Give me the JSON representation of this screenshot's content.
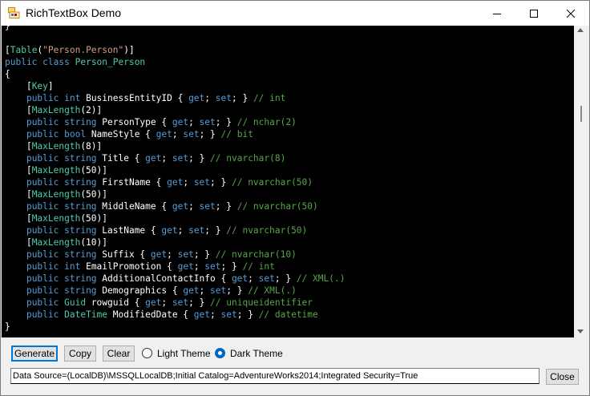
{
  "window": {
    "title": "RichTextBox Demo",
    "icon": "app-icon"
  },
  "title_buttons": {
    "minimize": "minimize-icon",
    "maximize": "maximize-icon",
    "close": "close-icon"
  },
  "colors": {
    "editor_bg": "#000000",
    "text": "#ffffff",
    "keyword": "#569cd6",
    "type": "#4ec9b0",
    "string": "#d69d85",
    "comment": "#57a64a",
    "accent": "#0078d7"
  },
  "code_lines": [
    [
      {
        "t": "}",
        "c": "text"
      }
    ],
    [
      {
        "t": "",
        "c": "text"
      }
    ],
    [
      {
        "t": "[",
        "c": "text"
      },
      {
        "t": "Table",
        "c": "type"
      },
      {
        "t": "(",
        "c": "text"
      },
      {
        "t": "\"Person.Person\"",
        "c": "string"
      },
      {
        "t": ")]",
        "c": "text"
      }
    ],
    [
      {
        "t": "public",
        "c": "keyword"
      },
      {
        "t": " ",
        "c": "text"
      },
      {
        "t": "class",
        "c": "keyword"
      },
      {
        "t": " ",
        "c": "text"
      },
      {
        "t": "Person_Person",
        "c": "type"
      }
    ],
    [
      {
        "t": "{",
        "c": "text"
      }
    ],
    [
      {
        "t": "    [",
        "c": "text"
      },
      {
        "t": "Key",
        "c": "type"
      },
      {
        "t": "]",
        "c": "text"
      }
    ],
    [
      {
        "t": "    ",
        "c": "text"
      },
      {
        "t": "public",
        "c": "keyword"
      },
      {
        "t": " ",
        "c": "text"
      },
      {
        "t": "int",
        "c": "keyword"
      },
      {
        "t": " BusinessEntityID { ",
        "c": "text"
      },
      {
        "t": "get",
        "c": "keyword"
      },
      {
        "t": "; ",
        "c": "text"
      },
      {
        "t": "set",
        "c": "keyword"
      },
      {
        "t": "; } ",
        "c": "text"
      },
      {
        "t": "// int",
        "c": "comment"
      }
    ],
    [
      {
        "t": "    [",
        "c": "text"
      },
      {
        "t": "MaxLength",
        "c": "type"
      },
      {
        "t": "(2)]",
        "c": "text"
      }
    ],
    [
      {
        "t": "    ",
        "c": "text"
      },
      {
        "t": "public",
        "c": "keyword"
      },
      {
        "t": " ",
        "c": "text"
      },
      {
        "t": "string",
        "c": "keyword"
      },
      {
        "t": " PersonType { ",
        "c": "text"
      },
      {
        "t": "get",
        "c": "keyword"
      },
      {
        "t": "; ",
        "c": "text"
      },
      {
        "t": "set",
        "c": "keyword"
      },
      {
        "t": "; } ",
        "c": "text"
      },
      {
        "t": "// nchar(2)",
        "c": "comment"
      }
    ],
    [
      {
        "t": "    ",
        "c": "text"
      },
      {
        "t": "public",
        "c": "keyword"
      },
      {
        "t": " ",
        "c": "text"
      },
      {
        "t": "bool",
        "c": "keyword"
      },
      {
        "t": " NameStyle { ",
        "c": "text"
      },
      {
        "t": "get",
        "c": "keyword"
      },
      {
        "t": "; ",
        "c": "text"
      },
      {
        "t": "set",
        "c": "keyword"
      },
      {
        "t": "; } ",
        "c": "text"
      },
      {
        "t": "// bit",
        "c": "comment"
      }
    ],
    [
      {
        "t": "    [",
        "c": "text"
      },
      {
        "t": "MaxLength",
        "c": "type"
      },
      {
        "t": "(8)]",
        "c": "text"
      }
    ],
    [
      {
        "t": "    ",
        "c": "text"
      },
      {
        "t": "public",
        "c": "keyword"
      },
      {
        "t": " ",
        "c": "text"
      },
      {
        "t": "string",
        "c": "keyword"
      },
      {
        "t": " Title { ",
        "c": "text"
      },
      {
        "t": "get",
        "c": "keyword"
      },
      {
        "t": "; ",
        "c": "text"
      },
      {
        "t": "set",
        "c": "keyword"
      },
      {
        "t": "; } ",
        "c": "text"
      },
      {
        "t": "// nvarchar(8)",
        "c": "comment"
      }
    ],
    [
      {
        "t": "    [",
        "c": "text"
      },
      {
        "t": "MaxLength",
        "c": "type"
      },
      {
        "t": "(50)]",
        "c": "text"
      }
    ],
    [
      {
        "t": "    ",
        "c": "text"
      },
      {
        "t": "public",
        "c": "keyword"
      },
      {
        "t": " ",
        "c": "text"
      },
      {
        "t": "string",
        "c": "keyword"
      },
      {
        "t": " FirstName { ",
        "c": "text"
      },
      {
        "t": "get",
        "c": "keyword"
      },
      {
        "t": "; ",
        "c": "text"
      },
      {
        "t": "set",
        "c": "keyword"
      },
      {
        "t": "; } ",
        "c": "text"
      },
      {
        "t": "// nvarchar(50)",
        "c": "comment"
      }
    ],
    [
      {
        "t": "    [",
        "c": "text"
      },
      {
        "t": "MaxLength",
        "c": "type"
      },
      {
        "t": "(50)]",
        "c": "text"
      }
    ],
    [
      {
        "t": "    ",
        "c": "text"
      },
      {
        "t": "public",
        "c": "keyword"
      },
      {
        "t": " ",
        "c": "text"
      },
      {
        "t": "string",
        "c": "keyword"
      },
      {
        "t": " MiddleName { ",
        "c": "text"
      },
      {
        "t": "get",
        "c": "keyword"
      },
      {
        "t": "; ",
        "c": "text"
      },
      {
        "t": "set",
        "c": "keyword"
      },
      {
        "t": "; } ",
        "c": "text"
      },
      {
        "t": "// nvarchar(50)",
        "c": "comment"
      }
    ],
    [
      {
        "t": "    [",
        "c": "text"
      },
      {
        "t": "MaxLength",
        "c": "type"
      },
      {
        "t": "(50)]",
        "c": "text"
      }
    ],
    [
      {
        "t": "    ",
        "c": "text"
      },
      {
        "t": "public",
        "c": "keyword"
      },
      {
        "t": " ",
        "c": "text"
      },
      {
        "t": "string",
        "c": "keyword"
      },
      {
        "t": " LastName { ",
        "c": "text"
      },
      {
        "t": "get",
        "c": "keyword"
      },
      {
        "t": "; ",
        "c": "text"
      },
      {
        "t": "set",
        "c": "keyword"
      },
      {
        "t": "; } ",
        "c": "text"
      },
      {
        "t": "// nvarchar(50)",
        "c": "comment"
      }
    ],
    [
      {
        "t": "    [",
        "c": "text"
      },
      {
        "t": "MaxLength",
        "c": "type"
      },
      {
        "t": "(10)]",
        "c": "text"
      }
    ],
    [
      {
        "t": "    ",
        "c": "text"
      },
      {
        "t": "public",
        "c": "keyword"
      },
      {
        "t": " ",
        "c": "text"
      },
      {
        "t": "string",
        "c": "keyword"
      },
      {
        "t": " Suffix { ",
        "c": "text"
      },
      {
        "t": "get",
        "c": "keyword"
      },
      {
        "t": "; ",
        "c": "text"
      },
      {
        "t": "set",
        "c": "keyword"
      },
      {
        "t": "; } ",
        "c": "text"
      },
      {
        "t": "// nvarchar(10)",
        "c": "comment"
      }
    ],
    [
      {
        "t": "    ",
        "c": "text"
      },
      {
        "t": "public",
        "c": "keyword"
      },
      {
        "t": " ",
        "c": "text"
      },
      {
        "t": "int",
        "c": "keyword"
      },
      {
        "t": " EmailPromotion { ",
        "c": "text"
      },
      {
        "t": "get",
        "c": "keyword"
      },
      {
        "t": "; ",
        "c": "text"
      },
      {
        "t": "set",
        "c": "keyword"
      },
      {
        "t": "; } ",
        "c": "text"
      },
      {
        "t": "// int",
        "c": "comment"
      }
    ],
    [
      {
        "t": "    ",
        "c": "text"
      },
      {
        "t": "public",
        "c": "keyword"
      },
      {
        "t": " ",
        "c": "text"
      },
      {
        "t": "string",
        "c": "keyword"
      },
      {
        "t": " AdditionalContactInfo { ",
        "c": "text"
      },
      {
        "t": "get",
        "c": "keyword"
      },
      {
        "t": "; ",
        "c": "text"
      },
      {
        "t": "set",
        "c": "keyword"
      },
      {
        "t": "; } ",
        "c": "text"
      },
      {
        "t": "// XML(.)",
        "c": "comment"
      }
    ],
    [
      {
        "t": "    ",
        "c": "text"
      },
      {
        "t": "public",
        "c": "keyword"
      },
      {
        "t": " ",
        "c": "text"
      },
      {
        "t": "string",
        "c": "keyword"
      },
      {
        "t": " Demographics { ",
        "c": "text"
      },
      {
        "t": "get",
        "c": "keyword"
      },
      {
        "t": "; ",
        "c": "text"
      },
      {
        "t": "set",
        "c": "keyword"
      },
      {
        "t": "; } ",
        "c": "text"
      },
      {
        "t": "// XML(.)",
        "c": "comment"
      }
    ],
    [
      {
        "t": "    ",
        "c": "text"
      },
      {
        "t": "public",
        "c": "keyword"
      },
      {
        "t": " ",
        "c": "text"
      },
      {
        "t": "Guid",
        "c": "type"
      },
      {
        "t": " rowguid { ",
        "c": "text"
      },
      {
        "t": "get",
        "c": "keyword"
      },
      {
        "t": "; ",
        "c": "text"
      },
      {
        "t": "set",
        "c": "keyword"
      },
      {
        "t": "; } ",
        "c": "text"
      },
      {
        "t": "// uniqueidentifier",
        "c": "comment"
      }
    ],
    [
      {
        "t": "    ",
        "c": "text"
      },
      {
        "t": "public",
        "c": "keyword"
      },
      {
        "t": " ",
        "c": "text"
      },
      {
        "t": "DateTime",
        "c": "type"
      },
      {
        "t": " ModifiedDate { ",
        "c": "text"
      },
      {
        "t": "get",
        "c": "keyword"
      },
      {
        "t": "; ",
        "c": "text"
      },
      {
        "t": "set",
        "c": "keyword"
      },
      {
        "t": "; } ",
        "c": "text"
      },
      {
        "t": "// datetime",
        "c": "comment"
      }
    ],
    [
      {
        "t": "}",
        "c": "text"
      }
    ]
  ],
  "toolbar": {
    "generate_label": "Generate",
    "copy_label": "Copy",
    "clear_label": "Clear",
    "light_theme_label": "Light Theme",
    "dark_theme_label": "Dark Theme",
    "selected_theme": "Dark Theme"
  },
  "connection": {
    "value": "Data Source=(LocalDB)\\MSSQLLocalDB;Initial Catalog=AdventureWorks2014;Integrated Security=True"
  },
  "footer": {
    "close_label": "Close"
  }
}
